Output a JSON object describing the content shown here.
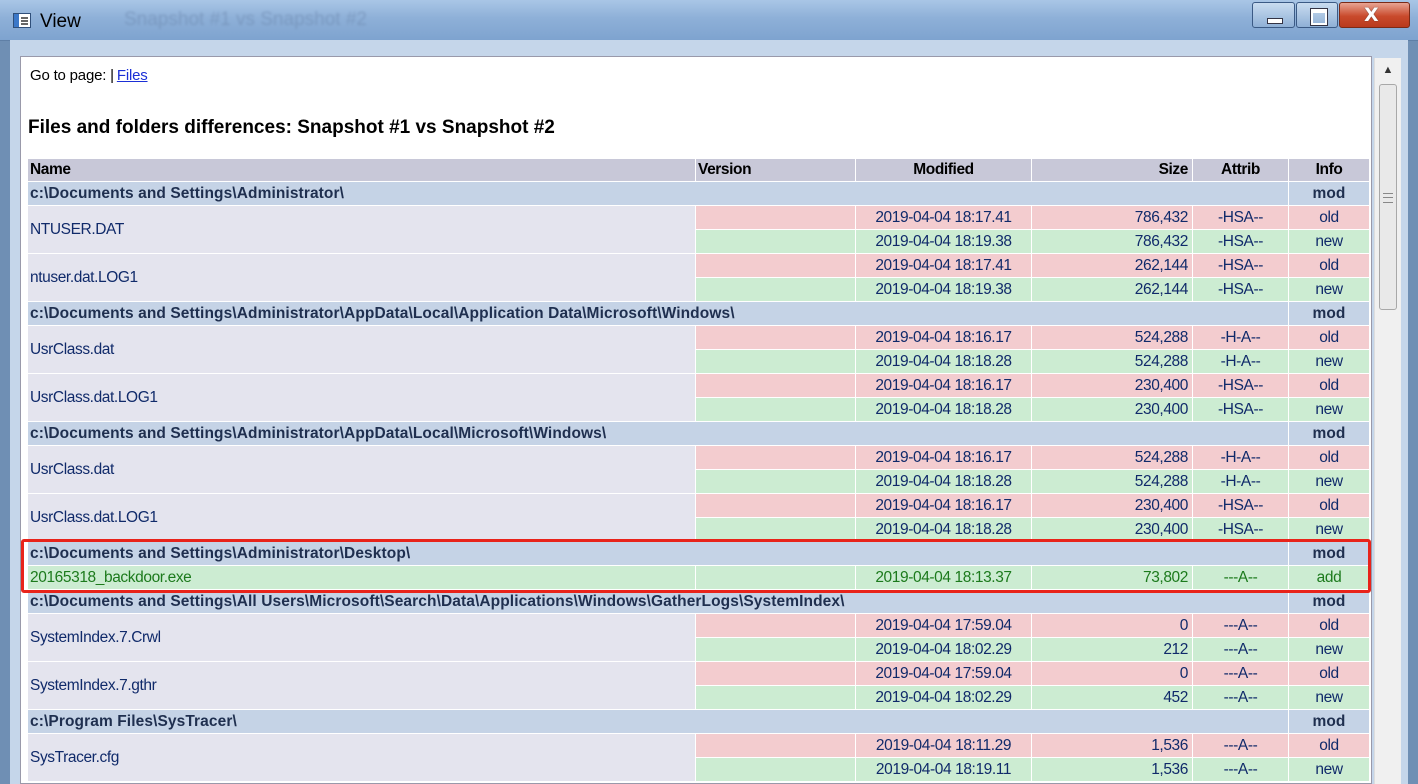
{
  "window": {
    "title": "View",
    "background_title": "Snapshot #1 vs Snapshot #2",
    "close_glyph": "X"
  },
  "nav": {
    "goto_label": "Go to page: |",
    "files_link": "Files"
  },
  "page_title": "Files and folders differences: Snapshot #1 vs Snapshot #2",
  "columns": {
    "name": "Name",
    "version": "Version",
    "modified": "Modified",
    "size": "Size",
    "attrib": "Attrib",
    "info": "Info"
  },
  "groups": [
    {
      "folder": "c:\\Documents and Settings\\Administrator\\",
      "status": "mod",
      "files": [
        {
          "name": "NTUSER.DAT",
          "old": {
            "modified": "2019-04-04 18:17.41",
            "size": "786,432",
            "attrib": "-HSA--",
            "info": "old"
          },
          "new": {
            "modified": "2019-04-04 18:19.38",
            "size": "786,432",
            "attrib": "-HSA--",
            "info": "new"
          }
        },
        {
          "name": "ntuser.dat.LOG1",
          "old": {
            "modified": "2019-04-04 18:17.41",
            "size": "262,144",
            "attrib": "-HSA--",
            "info": "old"
          },
          "new": {
            "modified": "2019-04-04 18:19.38",
            "size": "262,144",
            "attrib": "-HSA--",
            "info": "new"
          }
        }
      ]
    },
    {
      "folder": "c:\\Documents and Settings\\Administrator\\AppData\\Local\\Application Data\\Microsoft\\Windows\\",
      "status": "mod",
      "files": [
        {
          "name": "UsrClass.dat",
          "old": {
            "modified": "2019-04-04 18:16.17",
            "size": "524,288",
            "attrib": "-H-A--",
            "info": "old"
          },
          "new": {
            "modified": "2019-04-04 18:18.28",
            "size": "524,288",
            "attrib": "-H-A--",
            "info": "new"
          }
        },
        {
          "name": "UsrClass.dat.LOG1",
          "old": {
            "modified": "2019-04-04 18:16.17",
            "size": "230,400",
            "attrib": "-HSA--",
            "info": "old"
          },
          "new": {
            "modified": "2019-04-04 18:18.28",
            "size": "230,400",
            "attrib": "-HSA--",
            "info": "new"
          }
        }
      ]
    },
    {
      "folder": "c:\\Documents and Settings\\Administrator\\AppData\\Local\\Microsoft\\Windows\\",
      "status": "mod",
      "files": [
        {
          "name": "UsrClass.dat",
          "old": {
            "modified": "2019-04-04 18:16.17",
            "size": "524,288",
            "attrib": "-H-A--",
            "info": "old"
          },
          "new": {
            "modified": "2019-04-04 18:18.28",
            "size": "524,288",
            "attrib": "-H-A--",
            "info": "new"
          }
        },
        {
          "name": "UsrClass.dat.LOG1",
          "old": {
            "modified": "2019-04-04 18:16.17",
            "size": "230,400",
            "attrib": "-HSA--",
            "info": "old"
          },
          "new": {
            "modified": "2019-04-04 18:18.28",
            "size": "230,400",
            "attrib": "-HSA--",
            "info": "new"
          }
        }
      ]
    },
    {
      "folder": "c:\\Documents and Settings\\Administrator\\Desktop\\",
      "status": "mod",
      "added": {
        "name": "20165318_backdoor.exe",
        "modified": "2019-04-04 18:13.37",
        "size": "73,802",
        "attrib": "---A--",
        "info": "add"
      }
    },
    {
      "folder": "c:\\Documents and Settings\\All Users\\Microsoft\\Search\\Data\\Applications\\Windows\\GatherLogs\\SystemIndex\\",
      "status": "mod",
      "files": [
        {
          "name": "SystemIndex.7.Crwl",
          "old": {
            "modified": "2019-04-04 17:59.04",
            "size": "0",
            "attrib": "---A--",
            "info": "old"
          },
          "new": {
            "modified": "2019-04-04 18:02.29",
            "size": "212",
            "attrib": "---A--",
            "info": "new"
          }
        },
        {
          "name": "SystemIndex.7.gthr",
          "old": {
            "modified": "2019-04-04 17:59.04",
            "size": "0",
            "attrib": "---A--",
            "info": "old"
          },
          "new": {
            "modified": "2019-04-04 18:02.29",
            "size": "452",
            "attrib": "---A--",
            "info": "new"
          }
        }
      ]
    },
    {
      "folder": "c:\\Program Files\\SysTracer\\",
      "status": "mod",
      "files": [
        {
          "name": "SysTracer.cfg",
          "old": {
            "modified": "2019-04-04 18:11.29",
            "size": "1,536",
            "attrib": "---A--",
            "info": "old"
          },
          "new": {
            "modified": "2019-04-04 18:19.11",
            "size": "1,536",
            "attrib": "---A--",
            "info": "new"
          }
        }
      ]
    }
  ],
  "colors": {
    "old_row": "#f3cccf",
    "new_row": "#ccecd2",
    "folder_row": "#c5d3e6",
    "highlight": "#e8231a"
  }
}
